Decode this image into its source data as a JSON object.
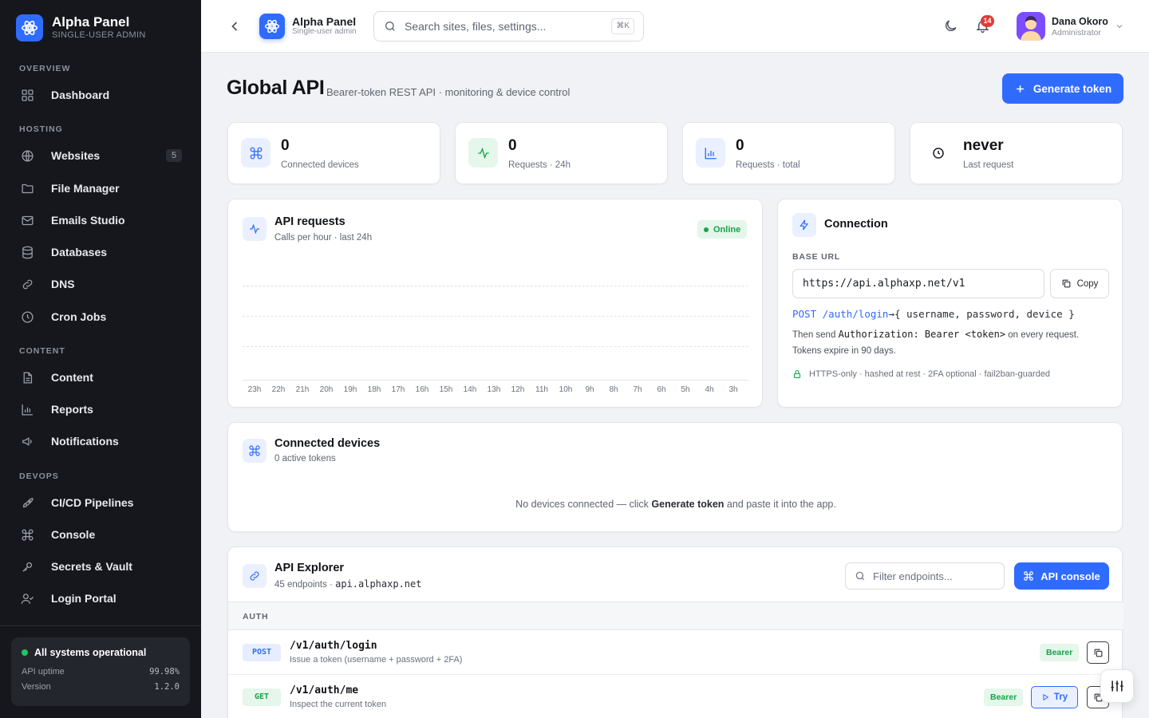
{
  "brand": {
    "name": "Alpha Panel",
    "subtitle": "SINGLE-USER ADMIN",
    "logo_icon": "atom-icon"
  },
  "sidebar": {
    "sections": [
      {
        "label": "OVERVIEW",
        "items": [
          {
            "label": "Dashboard",
            "icon": "grid-icon"
          }
        ]
      },
      {
        "label": "HOSTING",
        "items": [
          {
            "label": "Websites",
            "icon": "globe-icon",
            "badge": "5"
          },
          {
            "label": "File Manager",
            "icon": "folder-icon"
          },
          {
            "label": "Emails Studio",
            "icon": "mail-icon"
          },
          {
            "label": "Databases",
            "icon": "database-icon"
          },
          {
            "label": "DNS",
            "icon": "link-icon"
          },
          {
            "label": "Cron Jobs",
            "icon": "clock-icon"
          }
        ]
      },
      {
        "label": "CONTENT",
        "items": [
          {
            "label": "Content",
            "icon": "file-icon"
          },
          {
            "label": "Reports",
            "icon": "bar-chart-icon"
          },
          {
            "label": "Notifications",
            "icon": "megaphone-icon"
          }
        ]
      },
      {
        "label": "DEVOPS",
        "items": [
          {
            "label": "CI/CD Pipelines",
            "icon": "rocket-icon"
          },
          {
            "label": "Console",
            "icon": "command-icon"
          },
          {
            "label": "Secrets & Vault",
            "icon": "key-icon"
          },
          {
            "label": "Login Portal",
            "icon": "user-check-icon"
          }
        ]
      }
    ],
    "status": {
      "title": "All systems operational",
      "uptime_label": "API uptime",
      "uptime_value": "99.98%",
      "version_label": "Version",
      "version_value": "1.2.0"
    }
  },
  "topbar": {
    "title": "Alpha Panel",
    "subtitle": "Single-user admin",
    "search_placeholder": "Search sites, files, settings...",
    "search_shortcut": "⌘K",
    "notification_count": "14",
    "user": {
      "name": "Dana Okoro",
      "role": "Administrator"
    }
  },
  "page": {
    "title": "Global API",
    "subtitle": "Bearer-token REST API · monitoring & device control",
    "primary_action": "Generate token"
  },
  "stats": [
    {
      "value": "0",
      "label": "Connected devices",
      "icon": "command-icon",
      "accent": "#2f6bff"
    },
    {
      "value": "0",
      "label": "Requests · 24h",
      "icon": "activity-icon",
      "accent": "#16a34a"
    },
    {
      "value": "0",
      "label": "Requests · total",
      "icon": "bar-chart-icon",
      "accent": "#2f6bff"
    },
    {
      "value": "never",
      "label": "Last request",
      "icon": "clock-icon",
      "accent": "#1a1d24"
    }
  ],
  "requests_card": {
    "title": "API requests",
    "subtitle": "Calls per hour · last 24h",
    "status": "Online",
    "chart_data": {
      "type": "line",
      "title": "API requests",
      "x": [
        "23h",
        "22h",
        "21h",
        "20h",
        "19h",
        "18h",
        "17h",
        "16h",
        "15h",
        "14h",
        "13h",
        "12h",
        "11h",
        "10h",
        "9h",
        "8h",
        "7h",
        "6h",
        "5h",
        "4h",
        "3h"
      ],
      "series": [],
      "grid": true
    }
  },
  "connection": {
    "title": "Connection",
    "base_url_label": "BASE URL",
    "base_url": "https://api.alphaxp.net/v1",
    "copy_label": "Copy",
    "login_method": "POST",
    "login_path": "/auth/login",
    "login_arrow": "→",
    "login_body": "{ username, password, device }",
    "send_prefix": "Then send",
    "send_header": "Authorization: Bearer <token>",
    "send_suffix": "on every request.",
    "expiry": "Tokens expire in 90 days.",
    "security_note": "HTTPS-only · hashed at rest · 2FA optional · fail2ban-guarded"
  },
  "devices": {
    "title": "Connected devices",
    "subtitle": "0 active tokens",
    "empty_prefix": "No devices connected — click",
    "empty_action": "Generate token",
    "empty_suffix": "and paste it into the app."
  },
  "explorer": {
    "title": "API Explorer",
    "subtitle_count": "45 endpoints ·",
    "subtitle_host": "api.alphaxp.net",
    "filter_placeholder": "Filter endpoints...",
    "console_label": "API console",
    "group": "AUTH",
    "endpoints": [
      {
        "method": "POST",
        "path": "/v1/auth/login",
        "desc": "Issue a token (username + password + 2FA)",
        "auth": "Bearer"
      },
      {
        "method": "GET",
        "path": "/v1/auth/me",
        "desc": "Inspect the current token",
        "auth": "Bearer",
        "try": "Try"
      }
    ]
  }
}
